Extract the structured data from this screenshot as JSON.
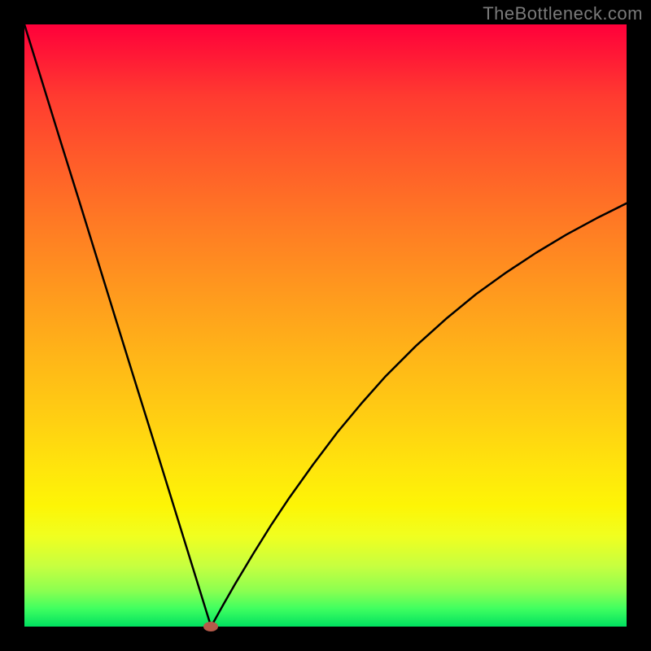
{
  "watermark": "TheBottleneck.com",
  "chart_data": {
    "type": "line",
    "title": "",
    "xlabel": "",
    "ylabel": "",
    "xlim": [
      0,
      100
    ],
    "ylim": [
      0,
      100
    ],
    "grid": false,
    "legend": false,
    "series": [
      {
        "name": "curve",
        "x": [
          0,
          3,
          6,
          9,
          12,
          15,
          18,
          21,
          24,
          27,
          30,
          31,
          32,
          33,
          35,
          38,
          41,
          44,
          48,
          52,
          56,
          60,
          65,
          70,
          75,
          80,
          85,
          90,
          95,
          100
        ],
        "y": [
          100,
          90.3,
          80.6,
          71.0,
          61.3,
          51.6,
          41.9,
          32.3,
          22.6,
          12.9,
          3.2,
          0,
          1.8,
          3.6,
          7.1,
          12.1,
          16.9,
          21.4,
          27.0,
          32.3,
          37.1,
          41.6,
          46.6,
          51.1,
          55.2,
          58.8,
          62.1,
          65.1,
          67.8,
          70.3
        ]
      }
    ],
    "annotations": [
      {
        "type": "point",
        "name": "minimum-marker",
        "x": 31,
        "y": 0,
        "color": "#b55a4a"
      }
    ],
    "background_gradient": {
      "top": "#ff003a",
      "bottom": "#00e060"
    }
  }
}
